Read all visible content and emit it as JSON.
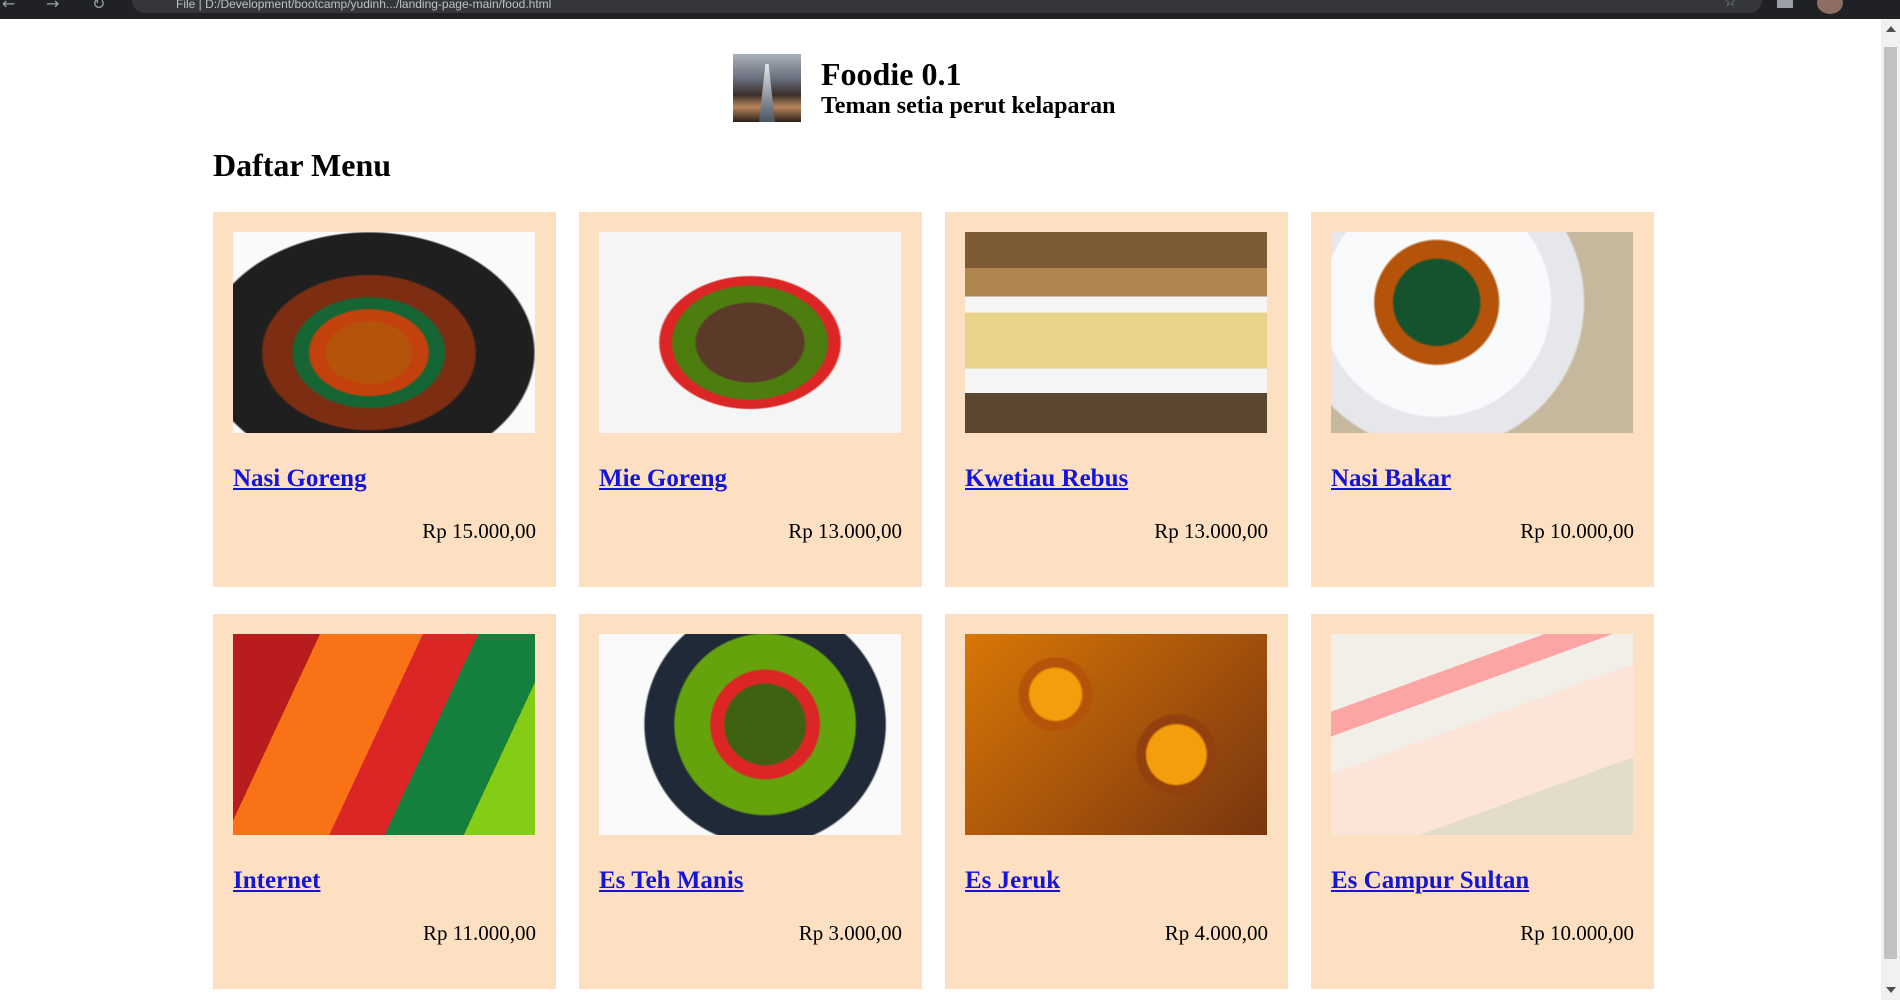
{
  "browser": {
    "url": "File | D:/Development/bootcamp/yudinh.../landing-page-main/food.html"
  },
  "header": {
    "title": "Foodie 0.1",
    "tagline": "Teman setia perut kelaparan"
  },
  "section_title": "Daftar Menu",
  "menu": [
    {
      "name": "Nasi Goreng",
      "price": "Rp 15.000,00"
    },
    {
      "name": "Mie Goreng",
      "price": "Rp 13.000,00"
    },
    {
      "name": "Kwetiau Rebus",
      "price": "Rp 13.000,00"
    },
    {
      "name": "Nasi Bakar",
      "price": "Rp 10.000,00"
    },
    {
      "name": "Internet",
      "price": "Rp 11.000,00"
    },
    {
      "name": "Es Teh Manis",
      "price": "Rp 3.000,00"
    },
    {
      "name": "Es Jeruk",
      "price": "Rp 4.000,00"
    },
    {
      "name": "Es Campur Sultan",
      "price": "Rp 10.000,00"
    }
  ],
  "colors": {
    "card_background": "#fde0c2",
    "link": "#1515d6"
  }
}
